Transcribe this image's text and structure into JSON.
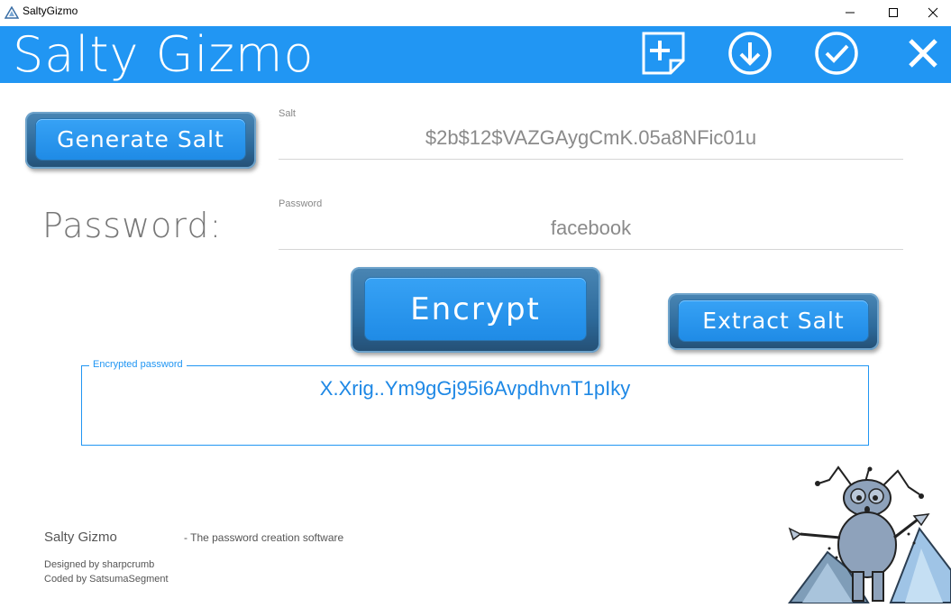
{
  "window": {
    "title": "SaltyGizmo",
    "icon": "triangle-app-icon",
    "controls": [
      "minimize-icon",
      "maximize-icon",
      "close-icon"
    ]
  },
  "header": {
    "brand": "Salty Gizmo",
    "actions": [
      "new-document-icon",
      "download-icon",
      "checkmark-icon",
      "close-icon"
    ],
    "color": "#2196f3"
  },
  "buttons": {
    "generate_salt": "Generate Salt",
    "encrypt": "Encrypt",
    "extract_salt": "Extract Salt"
  },
  "password_heading": "Password:",
  "fields": {
    "salt": {
      "label": "Salt",
      "value": "$2b$12$VAZGAygCmK.05a8NFic01u"
    },
    "password": {
      "label": "Password",
      "value": "facebook"
    }
  },
  "encrypted": {
    "label": "Encrypted password",
    "value": "X.Xrig..Ym9gGj95i6AvpdhvnT1pIky"
  },
  "footer": {
    "name": "Salty Gizmo",
    "tagline": "- The password creation software",
    "designed_by": "Designed by sharpcrumb",
    "coded_by": "Coded by SatsumaSegment"
  }
}
